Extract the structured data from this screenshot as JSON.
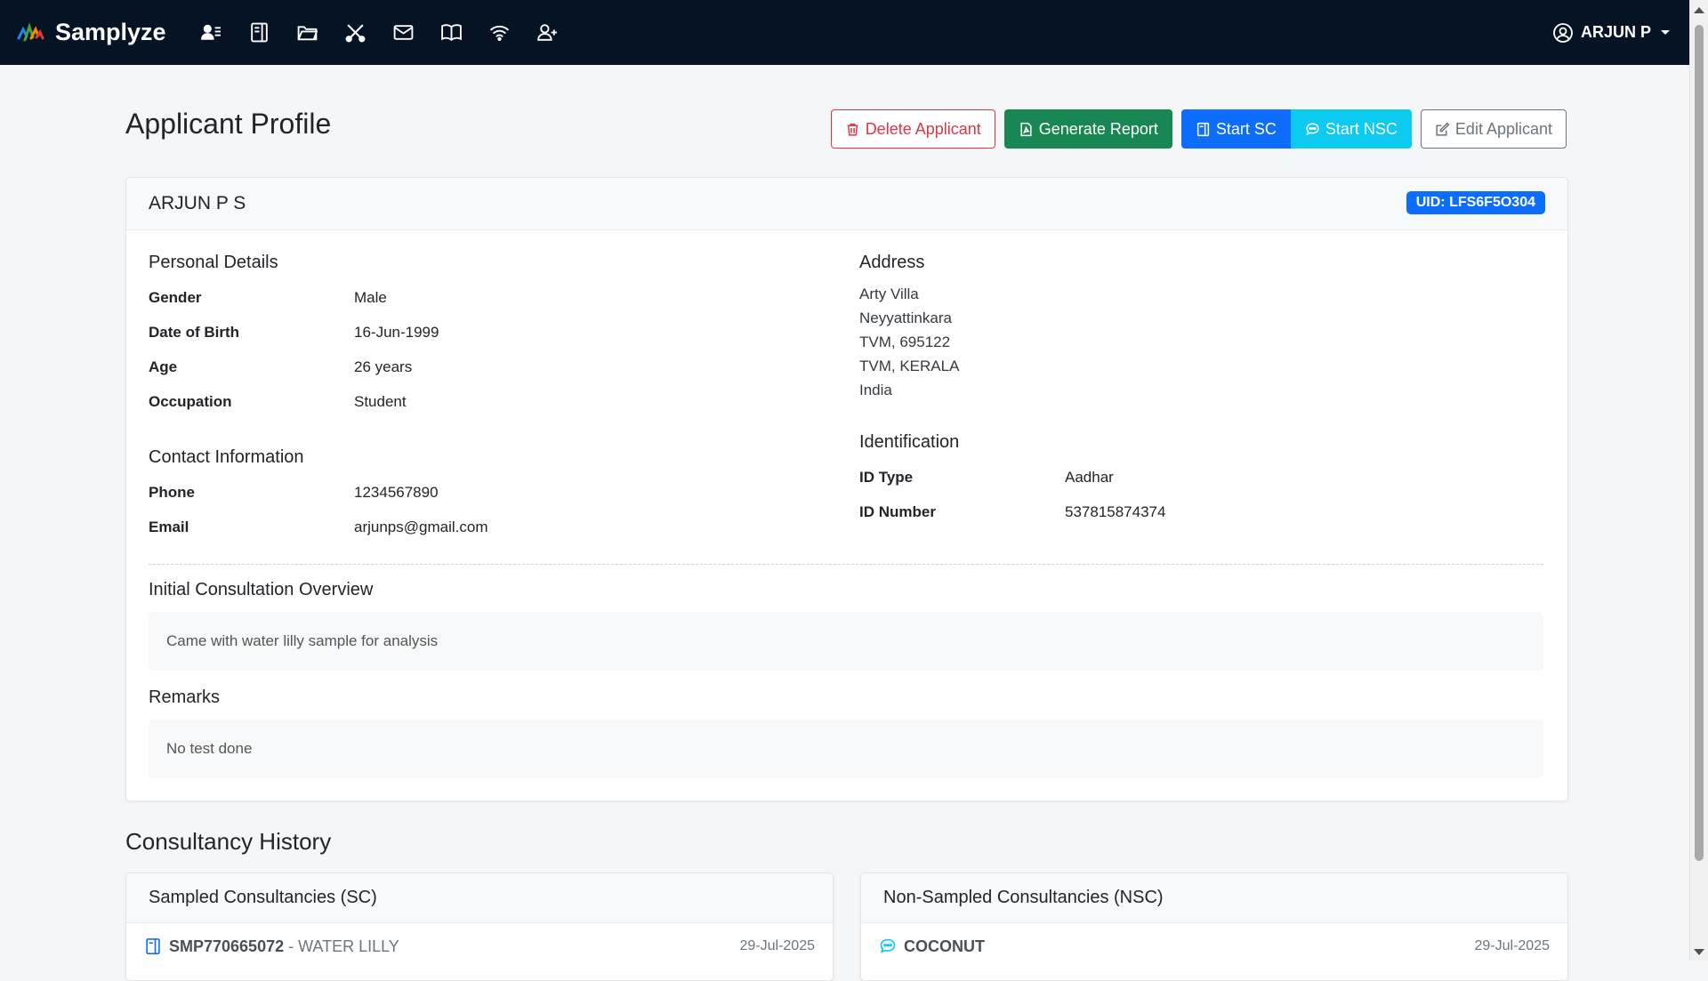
{
  "app": {
    "name": "Samplyze"
  },
  "nav": {
    "icons": [
      {
        "name": "applicants-icon"
      },
      {
        "name": "sampled-consultancy-icon"
      },
      {
        "name": "folder-icon"
      },
      {
        "name": "tools-icon"
      },
      {
        "name": "mail-icon"
      },
      {
        "name": "book-icon"
      },
      {
        "name": "wifi-icon"
      },
      {
        "name": "add-user-icon"
      }
    ],
    "user": "ARJUN P"
  },
  "page": {
    "title": "Applicant Profile",
    "actions": {
      "delete": "Delete Applicant",
      "report": "Generate Report",
      "start_sc": "Start SC",
      "start_nsc": "Start NSC",
      "edit": "Edit Applicant"
    }
  },
  "profile": {
    "name": "ARJUN P S",
    "uid": "UID: LFS6F5O304",
    "personal": {
      "title": "Personal Details",
      "gender_label": "Gender",
      "gender": "Male",
      "dob_label": "Date of Birth",
      "dob": "16-Jun-1999",
      "age_label": "Age",
      "age": "26 years",
      "occupation_label": "Occupation",
      "occupation": "Student"
    },
    "contact": {
      "title": "Contact Information",
      "phone_label": "Phone",
      "phone": "1234567890",
      "email_label": "Email",
      "email": "arjunps@gmail.com"
    },
    "address": {
      "title": "Address",
      "lines": [
        "Arty Villa",
        "Neyyattinkara",
        "TVM, 695122",
        "TVM, KERALA",
        "India"
      ]
    },
    "identification": {
      "title": "Identification",
      "type_label": "ID Type",
      "type": "Aadhar",
      "number_label": "ID Number",
      "number": "537815874374"
    },
    "consultation": {
      "title": "Initial Consultation Overview",
      "text": "Came with water lilly sample for analysis"
    },
    "remarks": {
      "title": "Remarks",
      "text": "No test done"
    }
  },
  "history": {
    "title": "Consultancy History",
    "sc": {
      "title": "Sampled Consultancies (SC)",
      "items": [
        {
          "code": "SMP770665072",
          "separator": "-",
          "sample": "WATER LILLY",
          "date": "29-Jul-2025"
        }
      ]
    },
    "nsc": {
      "title": "Non-Sampled Consultancies (NSC)",
      "items": [
        {
          "code": "COCONUT",
          "date": "29-Jul-2025"
        }
      ]
    }
  },
  "colors": {
    "navbar": "#061324",
    "danger": "#dc3545",
    "success": "#198754",
    "primary": "#0d6efd",
    "info": "#0dcaf0",
    "secondary": "#6c757d"
  }
}
